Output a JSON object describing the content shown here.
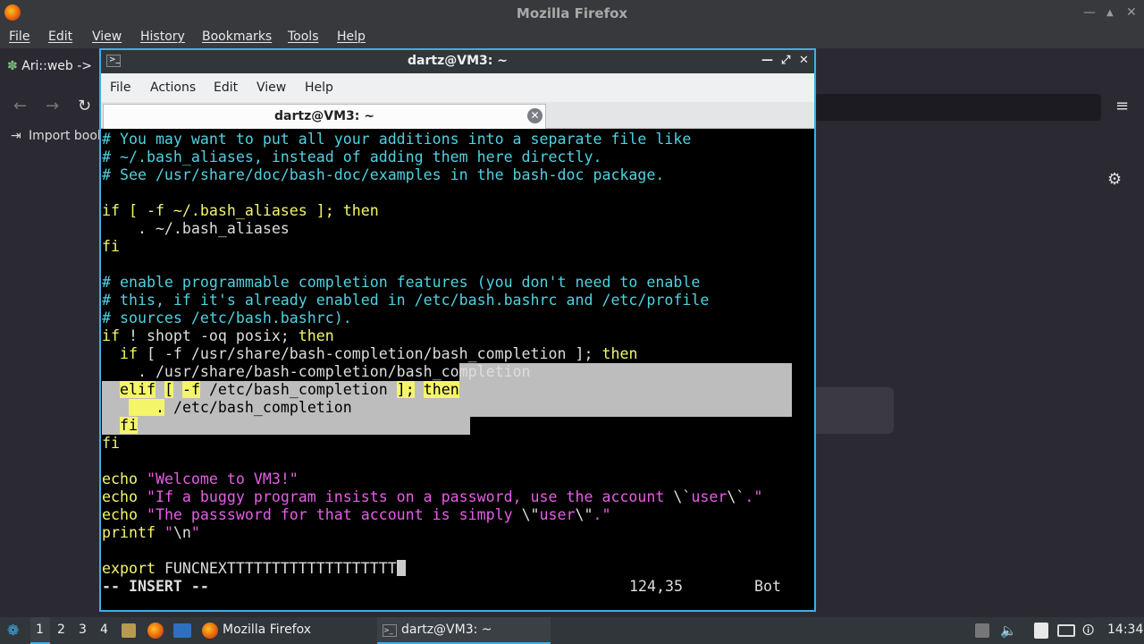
{
  "firefox": {
    "title": "Mozilla Firefox",
    "menu": [
      "File",
      "Edit",
      "View",
      "History",
      "Bookmarks",
      "Tools",
      "Help"
    ],
    "tab_label": "Ari::web ->",
    "bookmarks_label": "Import book",
    "window_controls": [
      "—",
      "▲",
      "✕"
    ]
  },
  "terminal": {
    "title": "dartz@VM3: ~",
    "menu": [
      "File",
      "Actions",
      "Edit",
      "View",
      "Help"
    ],
    "tab_title": "dartz@VM3: ~",
    "status": {
      "mode": "-- INSERT --",
      "position": "124,35",
      "scroll": "Bot"
    },
    "lines": {
      "l1": "# You may want to put all your additions into a separate file like",
      "l2": "# ~/.bash_aliases, instead of adding them here directly.",
      "l3": "# See /usr/share/doc/bash-doc/examples in the bash-doc package.",
      "l5a": "if [ -f ~/.bash_aliases ]; ",
      "l5b": "then",
      "l6": "    . ~/.bash_aliases",
      "l7": "fi",
      "l9": "# enable programmable completion features (you don't need to enable",
      "l10": "# this, if it's already enabled in /etc/bash.bashrc and /etc/profile",
      "l11": "# sources /etc/bash.bashrc).",
      "l12a": "if",
      "l12b": " ! shopt -oq posix; ",
      "l12c": "then",
      "l13a": "  if",
      "l13b": " [ -f /usr/share/bash-completion/bash_completion ]; ",
      "l13c": "then",
      "l14": "    . /usr/share/bash-completion/bash_completion",
      "l15a": "elif",
      "l15b": " ",
      "l15c": "[",
      "l15d": " ",
      "l15e": "-f",
      "l15f": " /etc/bash_completion ",
      "l15g": "];",
      "l15h": " ",
      "l15i": "then",
      "l16a": "   .",
      "l16b": " /etc/bash_completion",
      "l17": "fi",
      "l18": "fi",
      "l20a": "echo",
      "l20b": " \"Welcome to VM3!\"",
      "l21a": "echo",
      "l21b": " \"If a buggy program insists on a password, use the account ",
      "l21c": "\\`",
      "l21d": "user",
      "l21e": "\\`",
      "l21f": ".\"",
      "l22a": "echo",
      "l22b": " \"The passsword for that account is simply ",
      "l22c": "\\\"",
      "l22d": "user",
      "l22e": "\\\"",
      "l22f": ".\"",
      "l23a": "printf",
      "l23b": " \"",
      "l23c": "\\n",
      "l23d": "\"",
      "l25a": "export",
      "l25b": " FUNCNEXTTTTTTTTTTTTTTTTTTT"
    }
  },
  "taskbar": {
    "desktops": [
      "1",
      "2",
      "3",
      "4"
    ],
    "tasks": [
      {
        "label": "Mozilla Firefox"
      },
      {
        "label": "dartz@VM3: ~"
      }
    ],
    "clock": "14:34"
  }
}
